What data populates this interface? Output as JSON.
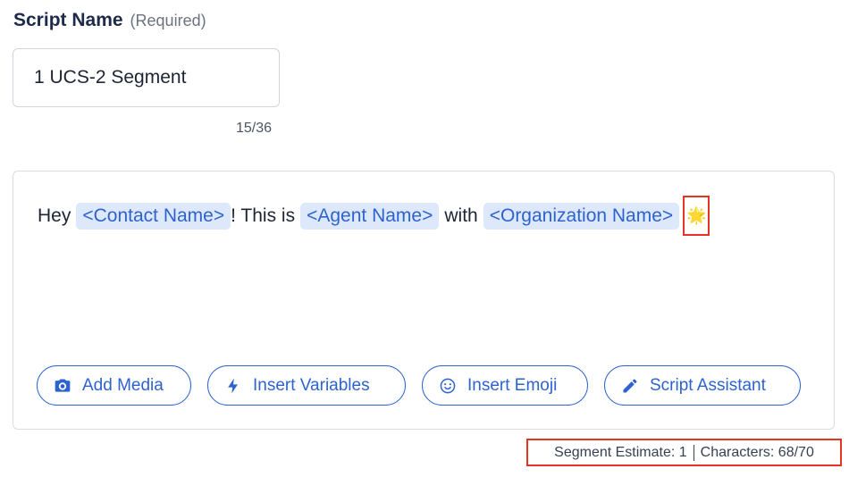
{
  "form": {
    "label": "Script Name",
    "required_hint": "(Required)",
    "name_value": "1 UCS-2 Segment",
    "name_counter": "15/36"
  },
  "script": {
    "text1": "Hey",
    "var1": "<Contact Name>",
    "text2": "! This is",
    "var2": "<Agent Name>",
    "text3": "with",
    "var3": "<Organization Name>",
    "emoji": "🌟"
  },
  "toolbar": {
    "add_media": "Add Media",
    "insert_variables": "Insert Variables",
    "insert_emoji": "Insert Emoji",
    "script_assistant": "Script Assistant"
  },
  "estimate": {
    "segment": "Segment Estimate: 1",
    "characters": "Characters: 68/70"
  },
  "colors": {
    "accent": "#2e63cf",
    "chip_bg": "#dde8fb",
    "highlight": "#e53423"
  }
}
